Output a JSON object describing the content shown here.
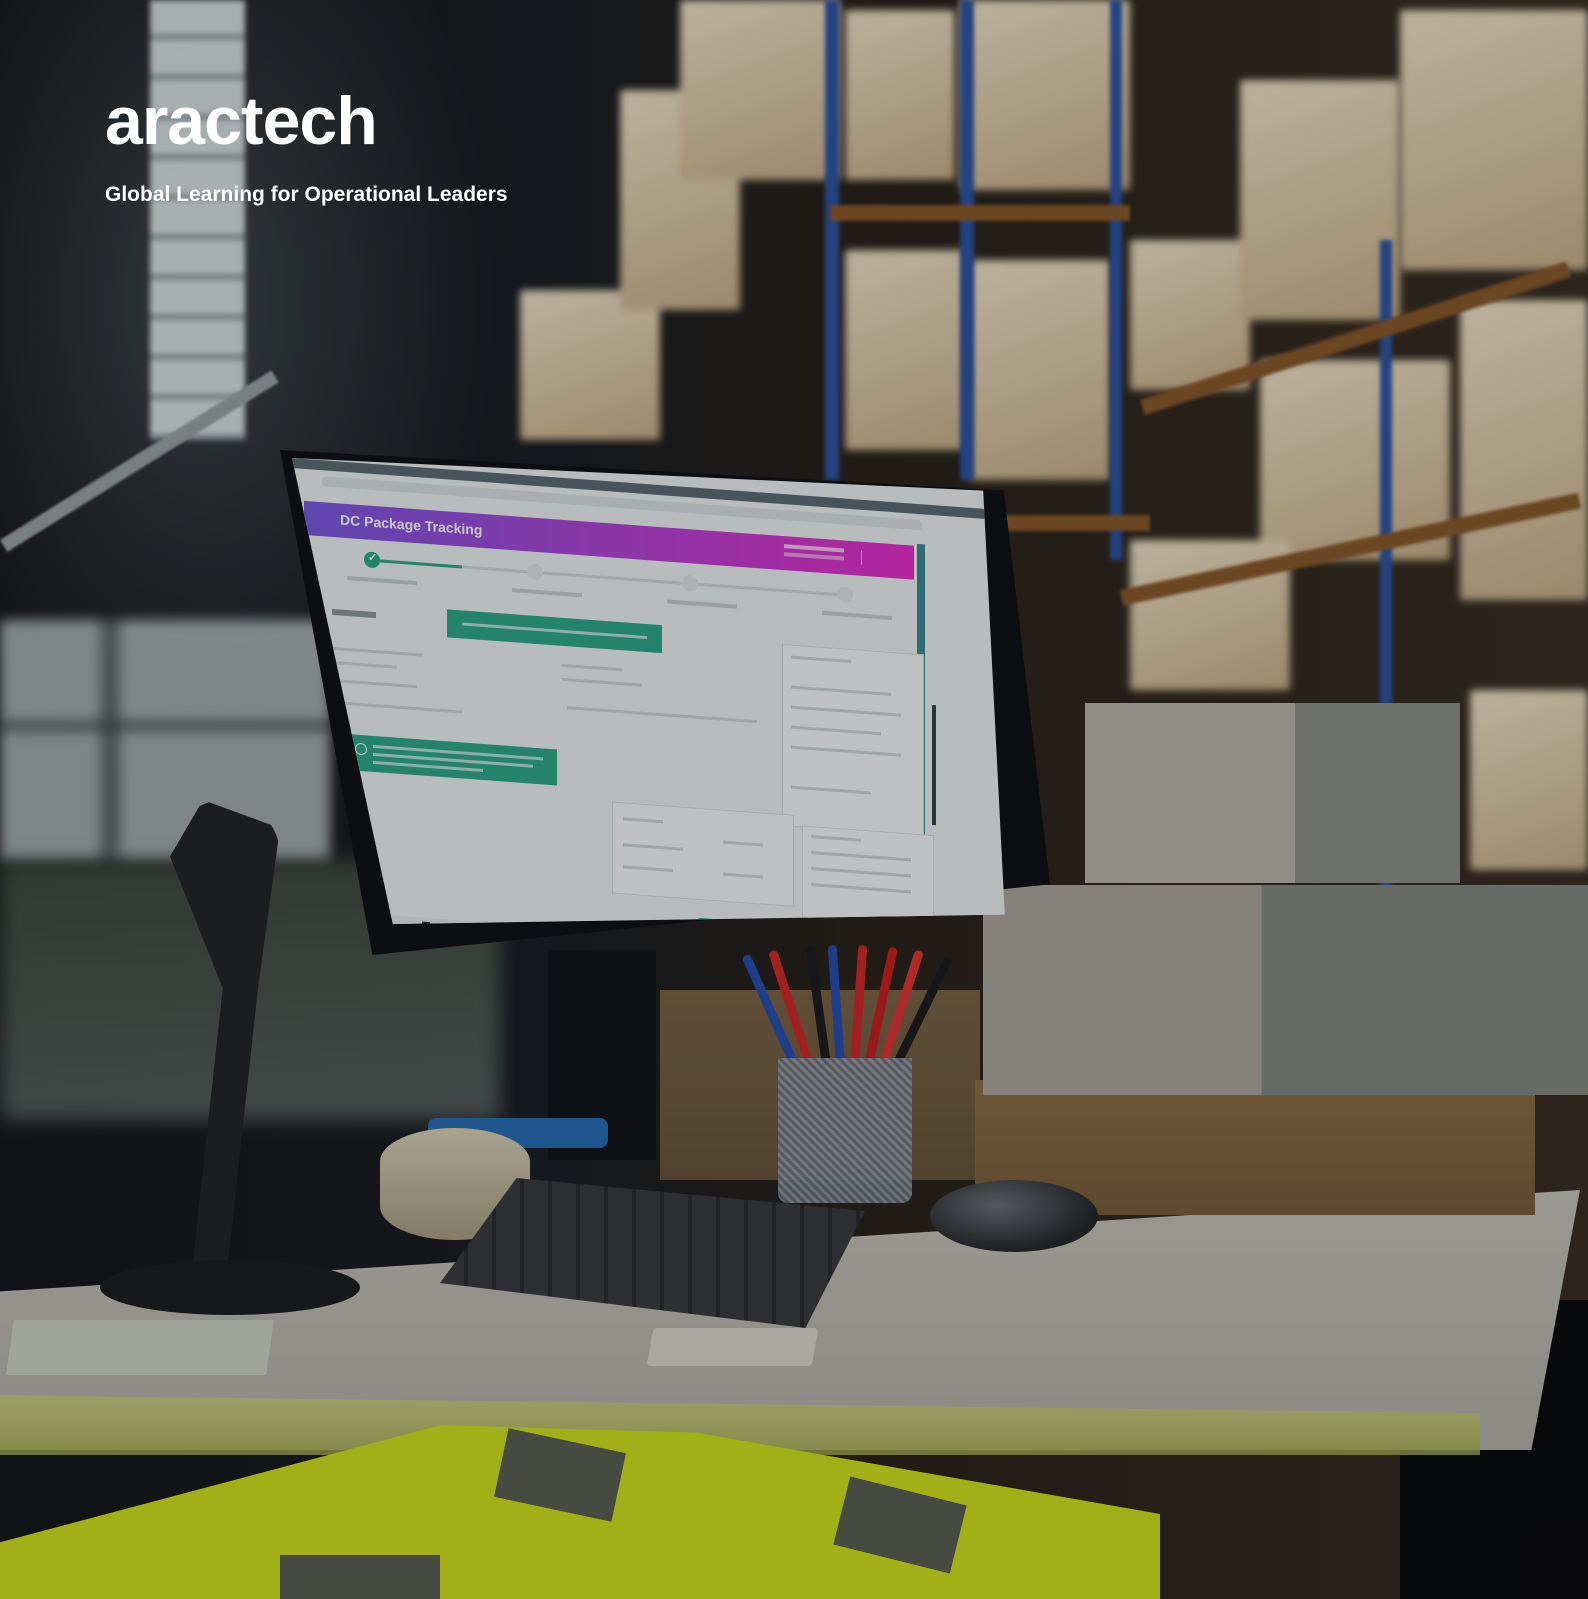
{
  "brand": {
    "name": "aractech",
    "tagline": "Global Learning for Operational Leaders"
  },
  "monitor_screen": {
    "app_title": "DC Package Tracking",
    "steps_completed": 1,
    "steps_total": 4
  },
  "colors": {
    "brand_text": "#ffffff",
    "header_gradient_start": "#7b5ae0",
    "header_gradient_end": "#e72fc9",
    "alert_green": "#2ea88a"
  },
  "icons": {
    "step_done": "check-icon"
  }
}
